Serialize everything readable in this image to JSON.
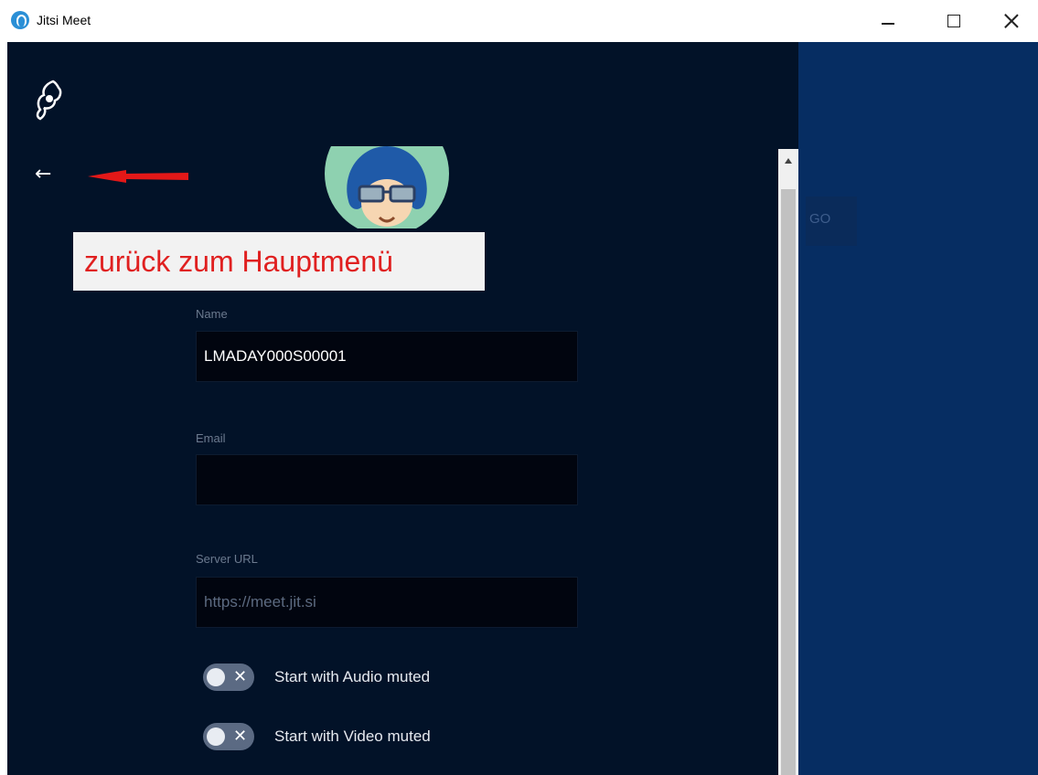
{
  "window": {
    "title": "Jitsi Meet"
  },
  "annotation": {
    "text": "zurück zum Hauptmenü",
    "color": "#e02020"
  },
  "form": {
    "name_label": "Name",
    "name_value": "LMADAY000S00001",
    "email_label": "Email",
    "email_value": "",
    "server_label": "Server URL",
    "server_placeholder": "https://meet.jit.si",
    "audio_toggle_label": "Start with Audio muted",
    "video_toggle_label": "Start with Video muted",
    "audio_toggle_on": false,
    "video_toggle_on": false
  },
  "right": {
    "go_label": "GO"
  },
  "colors": {
    "panel_bg": "#021228",
    "right_bg": "#062d62",
    "input_bg": "#01050f"
  },
  "icons": {
    "app": "jitsi-logo-icon",
    "back": "arrow-left-icon",
    "minimize": "minimize-icon",
    "maximize": "maximize-icon",
    "close": "close-icon"
  }
}
